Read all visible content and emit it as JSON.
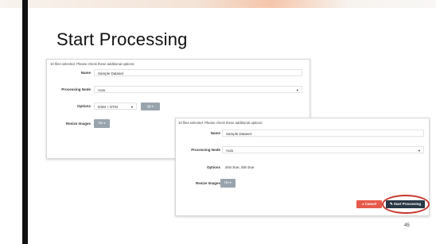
{
  "slide": {
    "title": "Start Processing",
    "page_number": "45"
  },
  "screenshot_1": {
    "info_text": "10 files selected. Please check these additional options:",
    "name_label": "Name",
    "name_value": "Sample Dataset",
    "node_label": "Processing Node",
    "node_value": "Auto",
    "options_label": "Options",
    "options_value": "DSM + DTM",
    "resize_label": "Resize Images",
    "resize_value": "No ▾"
  },
  "screenshot_2": {
    "info_text": "10 files selected. Please check these additional options:",
    "name_label": "Name",
    "name_value": "Sample Dataset",
    "node_label": "Processing Node",
    "node_value": "Auto",
    "options_label": "Options",
    "options_value": "dsm:true, dtm:true",
    "resize_label": "Resize Images",
    "resize_value": "No ▾",
    "cancel_label": "● Cancel",
    "start_label": "✎ Start Processing"
  },
  "colors": {
    "annotation": "#c8342b",
    "cancel": "#e65a4b",
    "start": "#293846",
    "secondary_button": "#98a4ad"
  },
  "icons": {
    "select_caret": "▾",
    "settings": "▤"
  }
}
